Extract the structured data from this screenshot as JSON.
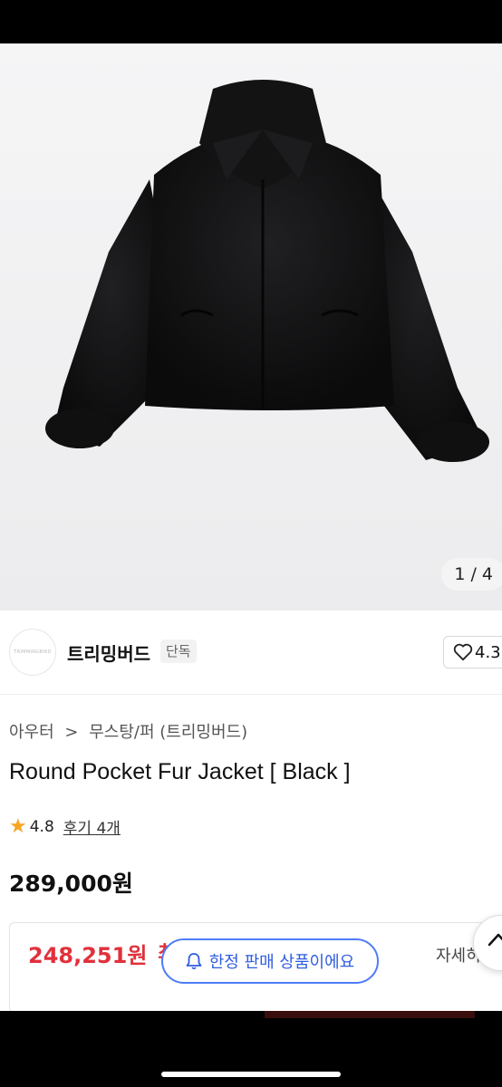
{
  "gallery": {
    "counter": "1 / 4"
  },
  "brand": {
    "logo_text": "TRIMMINGBIRD",
    "name": "트리밍버드",
    "badge": "단독"
  },
  "like": {
    "count": "4.3"
  },
  "breadcrumb": {
    "category": "아우터",
    "separator": ">",
    "subcategory": "무스탕/퍼 (트리밍버드)"
  },
  "product": {
    "title": "Round Pocket Fur Jacket [ Black ]",
    "rating": "4.8",
    "reviews": "후기 4개",
    "price": "289,000원"
  },
  "coupon": {
    "sale_price": "248,251원",
    "sale_suffix": "최",
    "detail": "자세히"
  },
  "toast": {
    "text": "한정 판매 상품이에요"
  },
  "colors": {
    "accent_blue": "#2f5de0",
    "sale_red": "#e0313c",
    "star": "#f5a623"
  }
}
